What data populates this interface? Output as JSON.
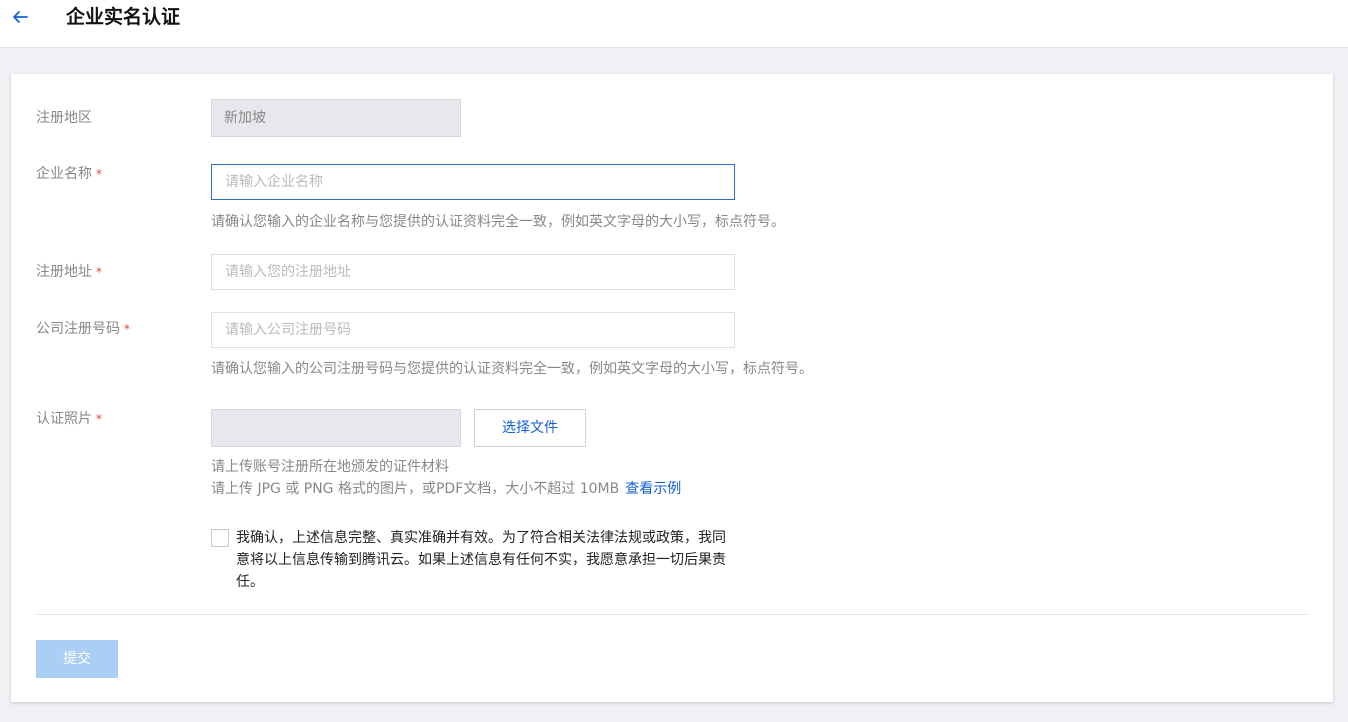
{
  "header": {
    "title": "企业实名认证"
  },
  "form": {
    "region": {
      "label": "注册地区",
      "value": "新加坡"
    },
    "company_name": {
      "label": "企业名称",
      "required_mark": "*",
      "placeholder": "请输入企业名称",
      "hint": "请确认您输入的企业名称与您提供的认证资料完全一致，例如英文字母的大小写，标点符号。"
    },
    "address": {
      "label": "注册地址",
      "required_mark": "*",
      "placeholder": "请输入您的注册地址"
    },
    "reg_number": {
      "label": "公司注册号码",
      "required_mark": "*",
      "placeholder": "请输入公司注册号码",
      "hint": "请确认您输入的公司注册号码与您提供的认证资料完全一致，例如英文字母的大小写，标点符号。"
    },
    "photo": {
      "label": "认证照片",
      "required_mark": "*",
      "button": "选择文件",
      "hint1": "请上传账号注册所在地颁发的证件材料",
      "hint2": "请上传 JPG 或 PNG 格式的图片，或PDF文档，大小不超过 10MB",
      "example_link": "查看示例"
    },
    "agreement": "我确认，上述信息完整、真实准确并有效。为了符合相关法律法规或政策，我同意将以上信息传输到腾讯云。如果上述信息有任何不实，我愿意承担一切后果责任。",
    "submit": "提交"
  },
  "colors": {
    "accent": "#1560d2",
    "submit_disabled": "#a9cff5",
    "required": "#e54545"
  },
  "icons": {
    "back": "arrow-left-icon"
  }
}
